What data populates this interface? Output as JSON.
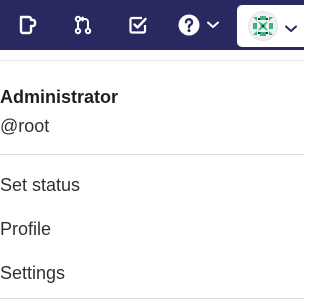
{
  "navbar": {
    "background_color": "#292961",
    "icons": [
      {
        "name": "issues-icon"
      },
      {
        "name": "merge-requests-icon"
      },
      {
        "name": "todos-icon"
      },
      {
        "name": "help-icon"
      }
    ],
    "avatar": {
      "name": "user-avatar",
      "accent_color": "#3bb57c"
    }
  },
  "user_menu": {
    "name": "Administrator",
    "username": "@root",
    "items": [
      {
        "label": "Set status"
      },
      {
        "label": "Profile"
      },
      {
        "label": "Settings"
      }
    ]
  }
}
